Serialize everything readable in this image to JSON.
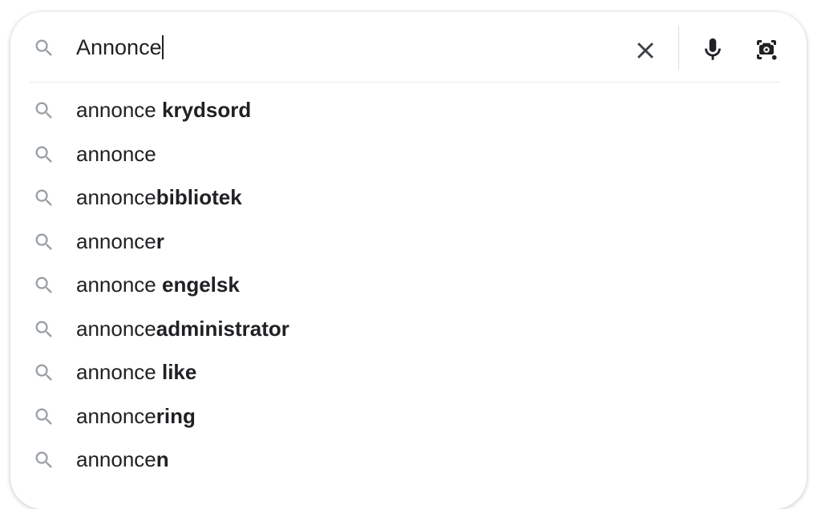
{
  "search": {
    "query": "Annonce",
    "clear_icon": "close-icon",
    "voice_icon": "microphone-icon",
    "lens_icon": "camera-lens-icon",
    "leading_icon": "search-icon"
  },
  "suggestions": [
    {
      "prefix": "annonce ",
      "completion": "krydsord"
    },
    {
      "prefix": "annonce",
      "completion": ""
    },
    {
      "prefix": "annonce",
      "completion": "bibliotek"
    },
    {
      "prefix": "annonce",
      "completion": "r"
    },
    {
      "prefix": "annonce ",
      "completion": "engelsk"
    },
    {
      "prefix": "annonce",
      "completion": "administrator"
    },
    {
      "prefix": "annonce ",
      "completion": "like"
    },
    {
      "prefix": "annonce",
      "completion": "ring"
    },
    {
      "prefix": "annonce",
      "completion": "n"
    }
  ],
  "colors": {
    "text": "#202124",
    "icon": "#70757a",
    "icon_dark": "#3c4043"
  }
}
